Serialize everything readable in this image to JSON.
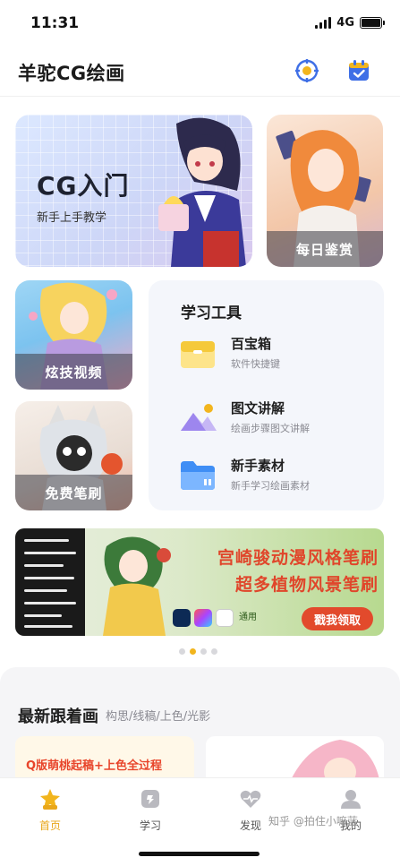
{
  "status": {
    "time": "11:31",
    "network": "4G"
  },
  "header": {
    "title": "羊驼CG绘画"
  },
  "cards": {
    "intro_title": "CG入门",
    "intro_sub": "新手上手教学",
    "daily": "每日鉴赏",
    "video": "炫技视频",
    "brush": "免费笔刷"
  },
  "tools": {
    "title": "学习工具",
    "items": [
      {
        "name": "百宝箱",
        "desc": "软件快捷键"
      },
      {
        "name": "图文讲解",
        "desc": "绘画步骤图文讲解"
      },
      {
        "name": "新手素材",
        "desc": "新手学习绘画素材"
      }
    ]
  },
  "banner": {
    "line1": "宫崎骏动漫风格笔刷",
    "line2": "超多植物风景笔刷",
    "cta": "戳我领取",
    "apps_label": "通用",
    "active_slide": 2,
    "total_slides": 4
  },
  "section": {
    "title": "最新跟着画",
    "tags": "构思/线稿/上色/光影",
    "card_a_caption": "Q版萌桃起稿+上色全过程"
  },
  "tabs": [
    {
      "label": "首页",
      "icon": "home-icon",
      "active": true
    },
    {
      "label": "学习",
      "icon": "learn-icon",
      "active": false
    },
    {
      "label": "发现",
      "icon": "discover-icon",
      "active": false
    },
    {
      "label": "我的",
      "icon": "profile-icon",
      "active": false
    }
  ],
  "watermark": "知乎 @拍住小嘛蓝",
  "colors": {
    "accent": "#f2b51d",
    "banner_red": "#e0462b",
    "brand_blue": "#3f6fe6"
  }
}
